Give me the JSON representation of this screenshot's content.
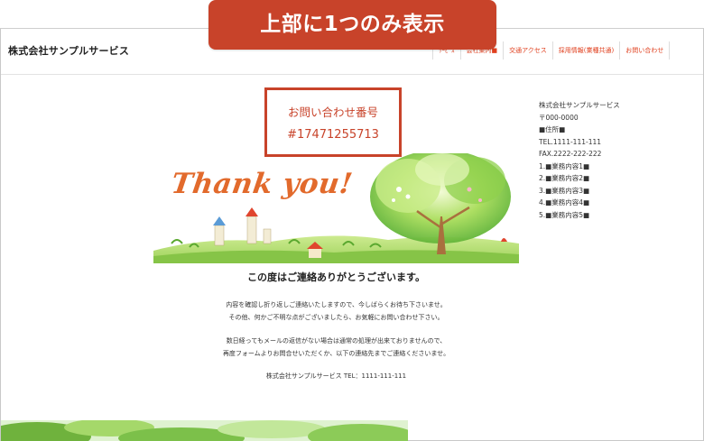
{
  "banner": {
    "text": "上部に1つのみ表示"
  },
  "header": {
    "site_title": "株式会社サンプルサービス",
    "nav": [
      {
        "label": "ｻｰﾋﾞｽ"
      },
      {
        "label": "会社案内■"
      },
      {
        "label": "交通アクセス"
      },
      {
        "label": "採用情報(業種共通)"
      },
      {
        "label": "お問い合わせ"
      }
    ]
  },
  "callout": {
    "label": "お問い合わせ番号",
    "number": "#17471255713"
  },
  "hero": {
    "text": "Thank you!"
  },
  "main": {
    "heading": "この度はご連絡ありがとうございます。",
    "para1_line1": "内容を確認し折り返しご連絡いたしますので、今しばらくお待ち下さいませ。",
    "para1_line2": "その他、何かご不明な点がございましたら、お気軽にお問い合わせ下さい。",
    "para2_line1": "数日経ってもメールの返信がない場合は通常の処理が出来ておりませんので、",
    "para2_line2": "再度フォームよりお問合せいただくか、以下の連絡先までご連絡くださいませ。",
    "company_line": "株式会社サンプルサービス TEL：1111-111-111"
  },
  "sidebar": {
    "lines": [
      "株式会社サンプルサービス",
      "〒000-0000",
      "■住所■",
      "TEL.1111-111-111",
      "FAX.2222-222-222",
      "1.■業務内容1■",
      "2.■業務内容2■",
      "3.■業務内容3■",
      "4.■業務内容4■",
      "5.■業務内容5■"
    ]
  },
  "colors": {
    "accent": "#c8432a",
    "nav_text": "#e0401f",
    "hero_text": "#e26a2c"
  }
}
